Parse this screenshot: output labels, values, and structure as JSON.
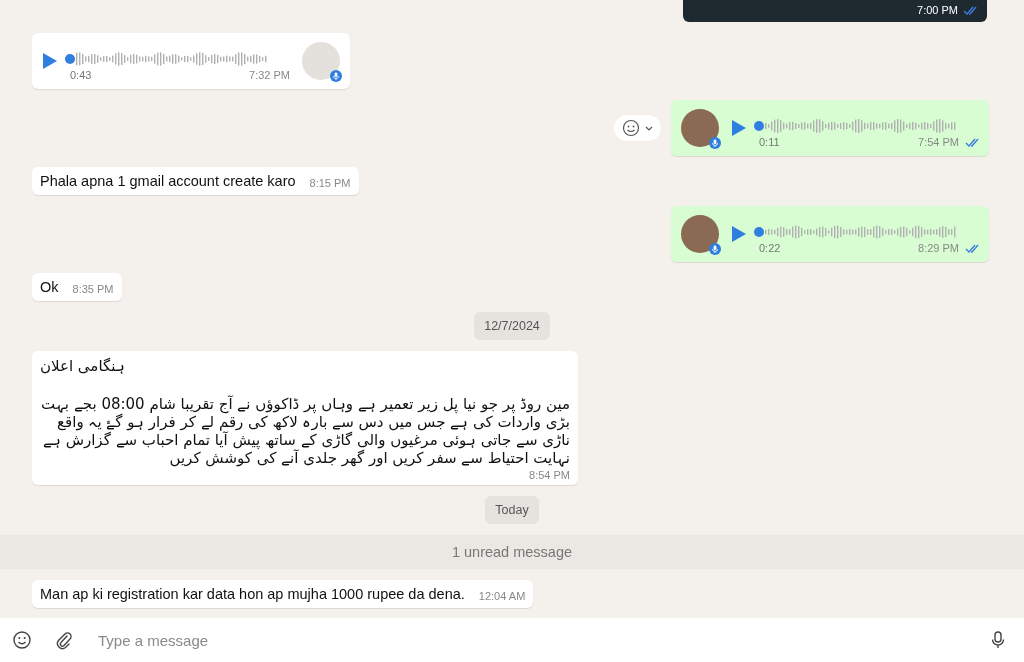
{
  "messages": [
    {
      "kind": "media",
      "outgoing": true,
      "time": "7:00 PM",
      "read": true
    },
    {
      "kind": "voice",
      "outgoing": false,
      "duration": "0:43",
      "time": "7:32 PM"
    },
    {
      "kind": "voice",
      "outgoing": true,
      "duration": "0:11",
      "time": "7:54 PM",
      "read": true,
      "reaction_button": true
    },
    {
      "kind": "text",
      "outgoing": false,
      "text": "Phala apna 1 gmail account create karo",
      "time": "8:15 PM"
    },
    {
      "kind": "voice",
      "outgoing": true,
      "duration": "0:22",
      "time": "8:29 PM",
      "read": true
    },
    {
      "kind": "text",
      "outgoing": false,
      "text": "Ok",
      "time": "8:35 PM"
    },
    {
      "kind": "date",
      "text": "12/7/2024"
    },
    {
      "kind": "announcement",
      "outgoing": false,
      "title": "ہنگامی اعلان",
      "text": "مین روڈ پر جو نیا پل زیر تعمیر ہے وہاں پر ڈاکوؤں نے آج تقریبا شام 08:00 بجے بہت بڑی واردات کی ہے جس میں دس سے بارہ لاکھ کی رقم لے کر فرار ہو گۓ یہ  واقع ناڑی سے جاتی ہوئی مرغیوں والی گاڑی کے ساتھ پیش آیا تمام احباب سے گزارش ہے  نہایت احتیاط سے سفر کریں اور گھر جلدی آنے کی کوشش کریں",
      "time": "8:54 PM"
    },
    {
      "kind": "date",
      "text": "Today"
    },
    {
      "kind": "unread",
      "text": "1 unread message"
    },
    {
      "kind": "text",
      "outgoing": false,
      "text": "Man ap ki registration kar data hon ap mujha 1000 rupee da dena.",
      "time": "12:04 AM"
    }
  ],
  "composer": {
    "placeholder": "Type a message"
  }
}
